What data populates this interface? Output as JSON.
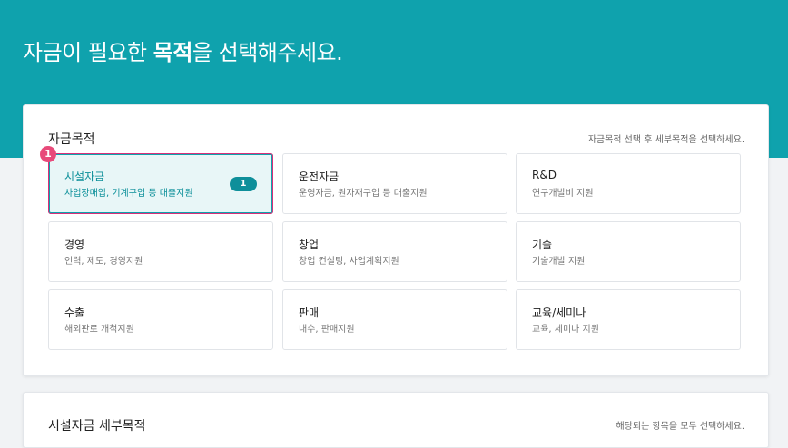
{
  "hero": {
    "title_prefix": "자금이 필요한 ",
    "title_bold": "목적",
    "title_suffix": "을 선택해주세요."
  },
  "purpose_section": {
    "title": "자금목적",
    "hint": "자금목적 선택 후 세부목적을 선택하세요.",
    "step_marker": "1",
    "tiles": [
      {
        "name": "시설자금",
        "desc": "사업장매입, 기계구입 등 대출지원",
        "selected": true,
        "count": "1"
      },
      {
        "name": "운전자금",
        "desc": "운영자금, 원자재구입 등 대출지원",
        "selected": false
      },
      {
        "name": "R&D",
        "desc": "연구개발비 지원",
        "selected": false
      },
      {
        "name": "경영",
        "desc": "인력, 제도, 경영지원",
        "selected": false
      },
      {
        "name": "창업",
        "desc": "창업 컨설팅, 사업계획지원",
        "selected": false
      },
      {
        "name": "기술",
        "desc": "기술개발 지원",
        "selected": false
      },
      {
        "name": "수출",
        "desc": "해외판로 개척지원",
        "selected": false
      },
      {
        "name": "판매",
        "desc": "내수, 판매지원",
        "selected": false
      },
      {
        "name": "교육/세미나",
        "desc": "교육, 세미나 지원",
        "selected": false
      }
    ]
  },
  "detail_section": {
    "title": "시설자금 세부목적",
    "hint": "해당되는 항목을 모두 선택하세요."
  },
  "colors": {
    "accent": "#0fa2ad",
    "badge": "#0e8f9a",
    "marker": "#e84a7a"
  }
}
